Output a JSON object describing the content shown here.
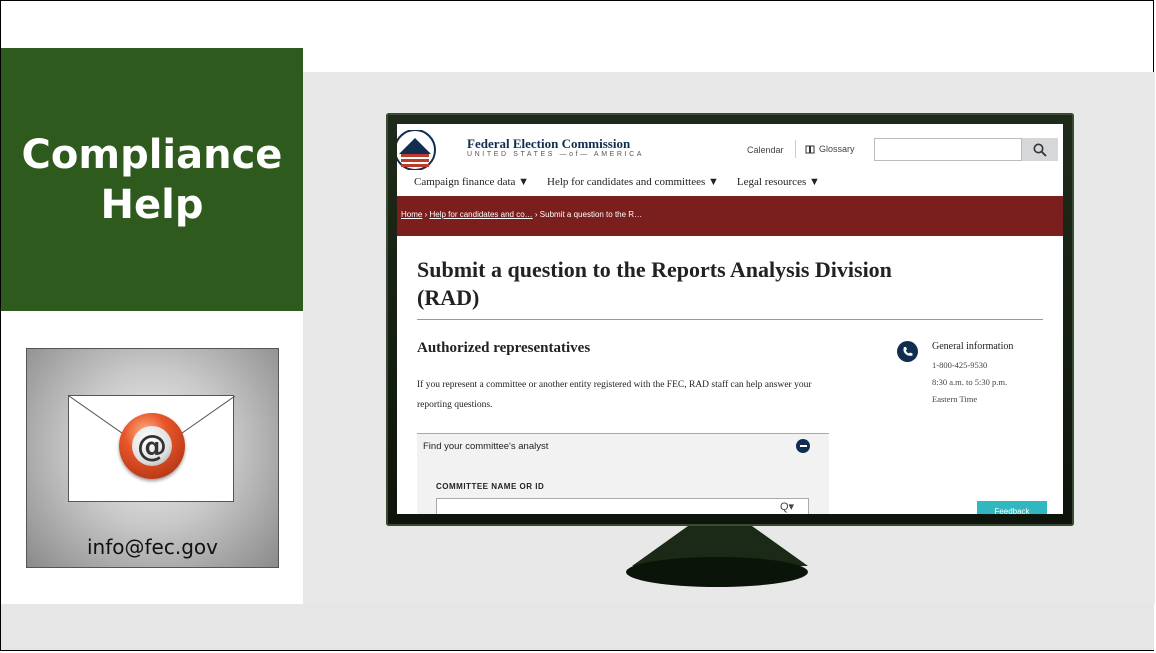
{
  "slide": {
    "title_line1": "Compliance",
    "title_line2": "Help",
    "email": "info@fec.gov",
    "colors": {
      "title_bg": "#2e5b1d",
      "crumb_bar": "#7a1e1e",
      "brand_navy": "#112e51",
      "feedback_btn": "#2fb8bf"
    }
  },
  "email_card": {
    "icon": "at-sign-icon",
    "envelope_icon": "envelope-icon"
  },
  "site": {
    "agency_name": "Federal Election Commission",
    "agency_sub": "UNITED STATES —of— AMERICA",
    "calendar": "Calendar",
    "glossary": "Glossary",
    "search_placeholder": "",
    "nav": [
      "Campaign finance data ▼",
      "Help for candidates and committees ▼",
      "Legal resources ▼"
    ],
    "breadcrumb": {
      "home": "Home",
      "sep1": "›",
      "help": "Help for candidates and co…",
      "sep2": "›",
      "current": "Submit a question to the R…"
    },
    "page_title": "Submit a question to the Reports Analysis Division (RAD)",
    "section_title": "Authorized representatives",
    "section_body": "If you represent a committee or another entity registered with the FEC, RAD staff can help answer your reporting questions.",
    "accordion_label": "Find your committee's analyst",
    "field_label": "COMMITTEE NAME OR ID",
    "field_value": "",
    "field_icon": "Q▾",
    "info": {
      "title": "General information",
      "phone": "1-800-425-9530",
      "hours": "8:30 a.m. to 5:30 p.m.",
      "tz": "Eastern Time"
    },
    "feedback": "Feedback"
  }
}
